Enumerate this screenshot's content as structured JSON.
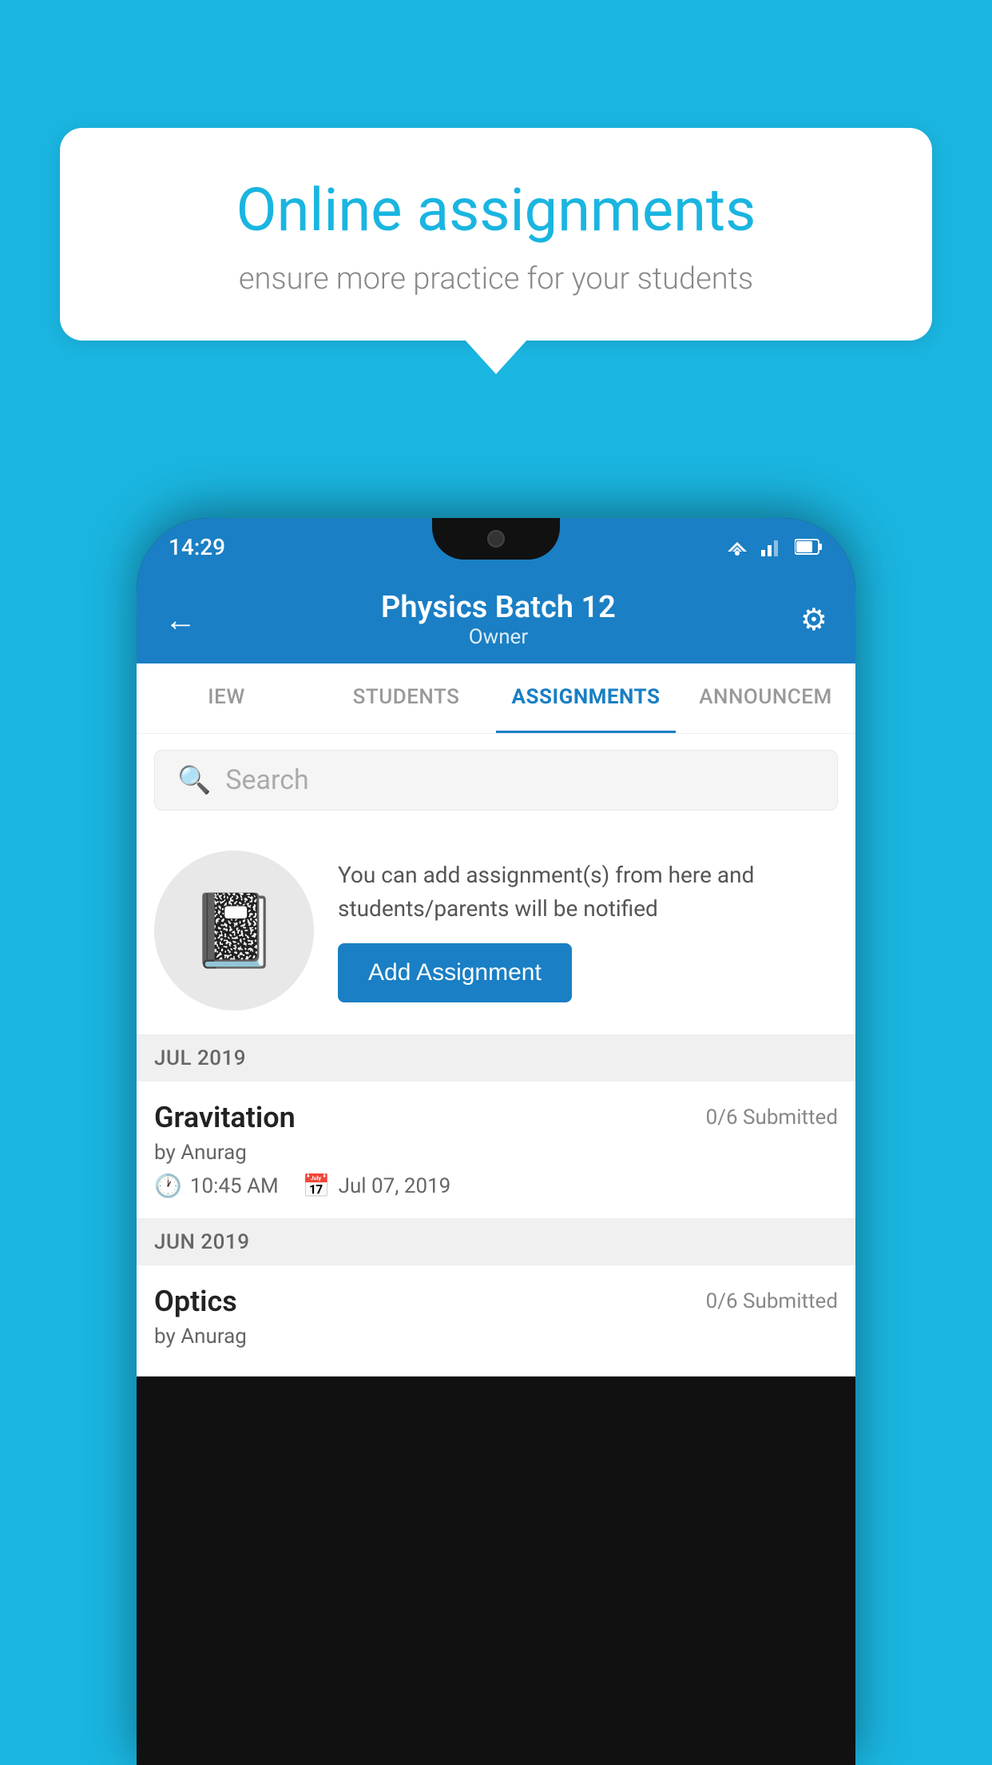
{
  "background": {
    "color": "#1ab5e0"
  },
  "speech_bubble": {
    "title": "Online assignments",
    "subtitle": "ensure more practice for your students"
  },
  "phone": {
    "status_bar": {
      "time": "14:29"
    },
    "header": {
      "title": "Physics Batch 12",
      "subtitle": "Owner"
    },
    "tabs": [
      {
        "label": "IEW",
        "active": false
      },
      {
        "label": "STUDENTS",
        "active": false
      },
      {
        "label": "ASSIGNMENTS",
        "active": true
      },
      {
        "label": "ANNOUNCEM",
        "active": false
      }
    ],
    "search": {
      "placeholder": "Search"
    },
    "promo": {
      "text": "You can add assignment(s) from here and students/parents will be notified",
      "button_label": "Add Assignment"
    },
    "sections": [
      {
        "header": "JUL 2019",
        "assignments": [
          {
            "name": "Gravitation",
            "submitted": "0/6 Submitted",
            "author": "by Anurag",
            "time": "10:45 AM",
            "date": "Jul 07, 2019"
          }
        ]
      },
      {
        "header": "JUN 2019",
        "assignments": [
          {
            "name": "Optics",
            "submitted": "0/6 Submitted",
            "author": "by Anurag",
            "time": "",
            "date": ""
          }
        ]
      }
    ]
  }
}
